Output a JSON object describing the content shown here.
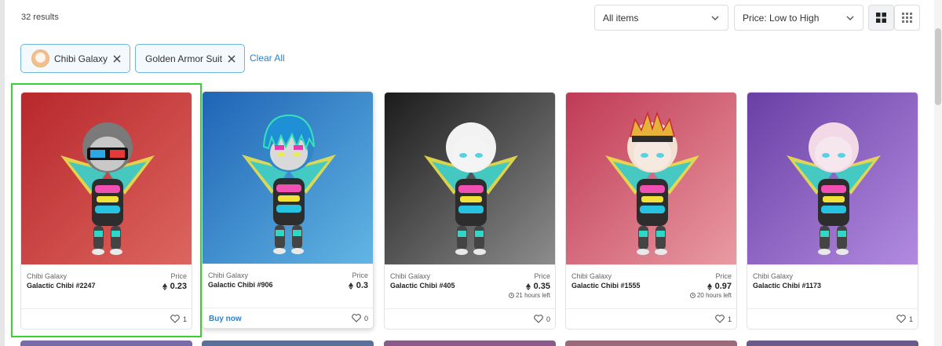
{
  "results_text": "32 results",
  "filters": {
    "items_select": "All items",
    "sort_select": "Price: Low to High"
  },
  "chips": [
    {
      "label": "Chibi Galaxy"
    },
    {
      "label": "Golden Armor Suit"
    }
  ],
  "clear_all": "Clear All",
  "cards": [
    {
      "collection": "Chibi Galaxy",
      "name": "Galactic Chibi #2247",
      "price_label": "Price",
      "price": "0.23",
      "time_left": "",
      "buy_now": "",
      "likes": "1",
      "bg_top": "#b8272c",
      "bg_bottom": "#dd6660"
    },
    {
      "collection": "Chibi Galaxy",
      "name": "Galactic Chibi #906",
      "price_label": "Price",
      "price": "0.3",
      "time_left": "",
      "buy_now": "Buy now",
      "likes": "0",
      "bg_top": "#1f64b6",
      "bg_bottom": "#62b6e4"
    },
    {
      "collection": "Chibi Galaxy",
      "name": "Galactic Chibi #405",
      "price_label": "Price",
      "price": "0.35",
      "time_left": "21 hours left",
      "buy_now": "",
      "likes": "0",
      "bg_top": "#1b1b1b",
      "bg_bottom": "#8d8d8d"
    },
    {
      "collection": "Chibi Galaxy",
      "name": "Galactic Chibi #1555",
      "price_label": "Price",
      "price": "0.97",
      "time_left": "20 hours left",
      "buy_now": "",
      "likes": "1",
      "bg_top": "#c03a55",
      "bg_bottom": "#e99ba3"
    },
    {
      "collection": "Chibi Galaxy",
      "name": "Galactic Chibi #1173",
      "price_label": "",
      "price": "",
      "time_left": "",
      "buy_now": "",
      "likes": "1",
      "bg_top": "#6a3fa5",
      "bg_bottom": "#b28be0"
    }
  ],
  "colors": {
    "accent": "#2f7fc8",
    "chip_border": "#6fb4dd",
    "highlight": "#35d42a"
  }
}
